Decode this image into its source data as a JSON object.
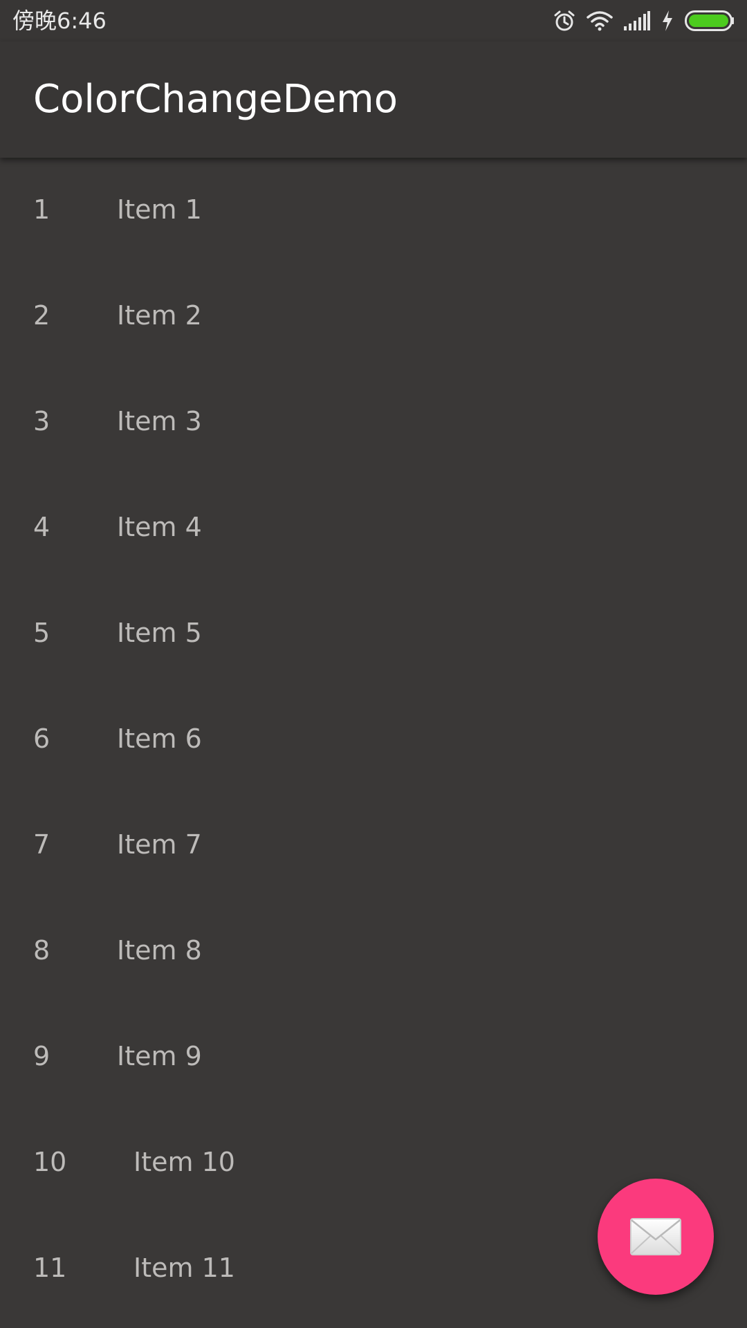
{
  "status_bar": {
    "time": "傍晚6:46",
    "icons": [
      "alarm-icon",
      "wifi-icon",
      "signal-icon",
      "charging-icon",
      "battery-icon"
    ],
    "battery_color": "#4ccb1e"
  },
  "app_bar": {
    "title": "ColorChangeDemo"
  },
  "list": {
    "items": [
      {
        "number": "1",
        "label": "Item 1"
      },
      {
        "number": "2",
        "label": "Item 2"
      },
      {
        "number": "3",
        "label": "Item 3"
      },
      {
        "number": "4",
        "label": "Item 4"
      },
      {
        "number": "5",
        "label": "Item 5"
      },
      {
        "number": "6",
        "label": "Item 6"
      },
      {
        "number": "7",
        "label": "Item 7"
      },
      {
        "number": "8",
        "label": "Item 8"
      },
      {
        "number": "9",
        "label": "Item 9"
      },
      {
        "number": "10",
        "label": "Item 10"
      },
      {
        "number": "11",
        "label": "Item 11"
      }
    ]
  },
  "fab": {
    "icon": "mail-icon",
    "color": "#fb3a7d"
  },
  "colors": {
    "background": "#3a3837",
    "app_bar": "#383635",
    "text_primary": "#ffffff",
    "text_list": "#bdbbb9"
  }
}
